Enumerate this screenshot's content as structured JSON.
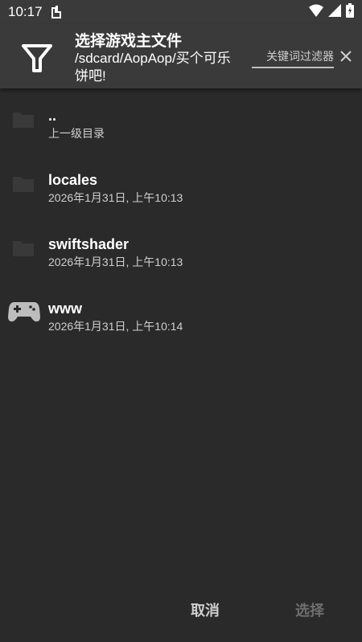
{
  "status_bar": {
    "time": "10:17"
  },
  "header": {
    "title": "选择游戏主文件",
    "path": "/sdcard/AopAop/买个可乐饼吧!",
    "filter_placeholder": "关键词过滤器"
  },
  "files": [
    {
      "name": "..",
      "subtitle": "上一级目录",
      "icon": "folder-icon"
    },
    {
      "name": "locales",
      "subtitle": "2026年1月31日, 上午10:13",
      "icon": "folder-icon"
    },
    {
      "name": "swiftshader",
      "subtitle": "2026年1月31日, 上午10:13",
      "icon": "folder-icon"
    },
    {
      "name": "www",
      "subtitle": "2026年1月31日, 上午10:14",
      "icon": "gamepad-icon"
    }
  ],
  "footer": {
    "cancel_label": "取消",
    "select_label": "选择"
  },
  "colors": {
    "background": "#2a2a2a",
    "header": "#3a3a3a",
    "disabled_text": "#6e6e6e"
  }
}
